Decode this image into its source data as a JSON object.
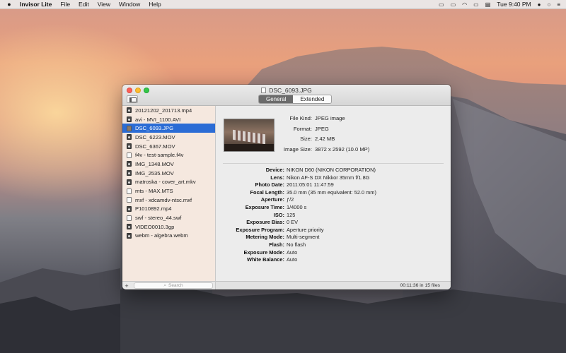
{
  "menubar": {
    "app_name": "Invisor Lite",
    "menus": [
      "File",
      "Edit",
      "View",
      "Window",
      "Help"
    ],
    "clock": "Tue 9:40 PM"
  },
  "window": {
    "title": "DSC_6093.JPG",
    "tabs": [
      {
        "label": "General",
        "active": true
      },
      {
        "label": "Extended",
        "active": false
      }
    ]
  },
  "sidebar": {
    "files": [
      {
        "name": "20121202_201713.mp4",
        "kind": "video",
        "selected": false
      },
      {
        "name": "avi - MVI_1100.AVI",
        "kind": "video",
        "selected": false
      },
      {
        "name": "DSC_6093.JPG",
        "kind": "image",
        "selected": true
      },
      {
        "name": "DSC_6223.MOV",
        "kind": "video",
        "selected": false
      },
      {
        "name": "DSC_6367.MOV",
        "kind": "video",
        "selected": false
      },
      {
        "name": "f4v - test-sample.f4v",
        "kind": "blank",
        "selected": false
      },
      {
        "name": "IMG_1348.MOV",
        "kind": "video",
        "selected": false
      },
      {
        "name": "IMG_2535.MOV",
        "kind": "video",
        "selected": false
      },
      {
        "name": "matroska - cover_art.mkv",
        "kind": "video",
        "selected": false
      },
      {
        "name": "mts - MAX.MTS",
        "kind": "blank",
        "selected": false
      },
      {
        "name": "mxf - xdcamdv-ntsc.mxf",
        "kind": "blank",
        "selected": false
      },
      {
        "name": "P1010892.mp4",
        "kind": "video",
        "selected": false
      },
      {
        "name": "swf - stereo_44.swf",
        "kind": "blank",
        "selected": false
      },
      {
        "name": "VIDEO0010.3gp",
        "kind": "video",
        "selected": false
      },
      {
        "name": "webm - algebra.webm",
        "kind": "video",
        "selected": false
      }
    ],
    "add_label": "+",
    "search_placeholder": "Search"
  },
  "general": [
    {
      "key": "File Kind:",
      "value": "JPEG image"
    },
    {
      "key": "Format:",
      "value": "JPEG"
    },
    {
      "key": "Size:",
      "value": "2.42 MB"
    },
    {
      "key": "Image Size:",
      "value": "3872 x 2592 (10.0 MP)"
    }
  ],
  "exif": [
    {
      "key": "Device:",
      "value": "NIKON D60 (NIKON CORPORATION)"
    },
    {
      "key": "Lens:",
      "value": "Nikon AF-S DX Nikkor 35mm f/1.8G"
    },
    {
      "key": "Photo Date:",
      "value": "2011:05:01 11:47:59"
    },
    {
      "key": "Focal Length:",
      "value": "35.0 mm (35 mm equivalent: 52.0 mm)"
    },
    {
      "key": "Aperture:",
      "value": "ƒ/2"
    },
    {
      "key": "Exposure Time:",
      "value": "1/4000 s"
    },
    {
      "key": "ISO:",
      "value": "125"
    },
    {
      "key": "Exposure Bias:",
      "value": "0 EV"
    },
    {
      "key": "Exposure Program:",
      "value": "Aperture priority"
    },
    {
      "key": "Metering Mode:",
      "value": "Multi-segment"
    },
    {
      "key": "Flash:",
      "value": "No flash"
    },
    {
      "key": "Exposure Mode:",
      "value": "Auto"
    },
    {
      "key": "White Balance:",
      "value": "Auto"
    }
  ],
  "status": "00:11:36 in 15 files",
  "colors": {
    "selection": "#2b6cd5",
    "close": "#fc5f57",
    "minimize": "#fdbc2e",
    "zoom": "#33c748"
  }
}
